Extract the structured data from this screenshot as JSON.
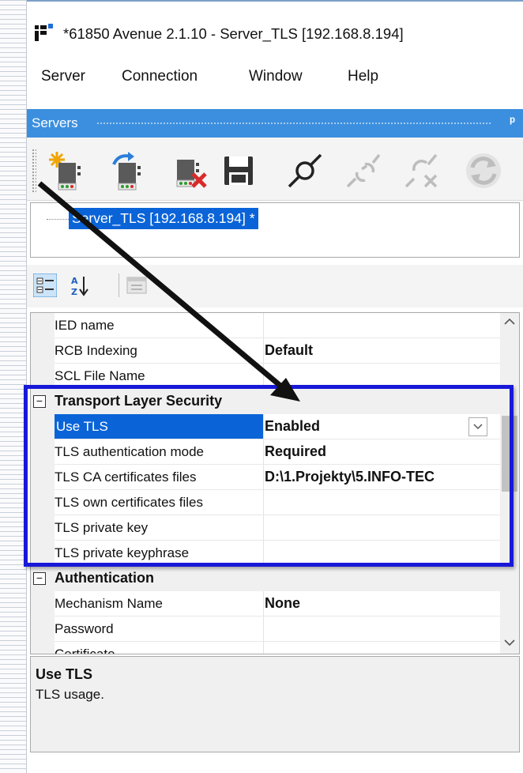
{
  "window": {
    "title": "*61850 Avenue 2.1.10 - Server_TLS [192.168.8.194]"
  },
  "menu": {
    "items": [
      "Server",
      "Connection",
      "Window",
      "Help"
    ]
  },
  "servers_panel": {
    "title": "Servers",
    "pin": "ᵖ",
    "node_label": "Server_TLS [192.168.8.194] *"
  },
  "toolbar": {
    "buttons": [
      "new-server-icon",
      "connect-server-icon",
      "delete-server-icon",
      "save-icon",
      "connect-icon",
      "disconnect-icon",
      "disconnect-all-icon",
      "refresh-icon"
    ]
  },
  "properties": {
    "rows_top": [
      {
        "name": "IED name",
        "value": ""
      },
      {
        "name": "RCB Indexing",
        "value": "Default"
      },
      {
        "name": "SCL File Name",
        "value": ""
      }
    ],
    "tls_category": "Transport Layer Security",
    "tls_rows": [
      {
        "name": "Use TLS",
        "value": "Enabled"
      },
      {
        "name": "TLS authentication mode",
        "value": "Required"
      },
      {
        "name": "TLS CA certificates files",
        "value": "D:\\1.Projekty\\5.INFO-TEC"
      },
      {
        "name": "TLS own certificates files",
        "value": ""
      },
      {
        "name": "TLS private key",
        "value": ""
      },
      {
        "name": "TLS private keyphrase",
        "value": ""
      }
    ],
    "auth_category": "Authentication",
    "auth_rows": [
      {
        "name": "Mechanism Name",
        "value": "None"
      },
      {
        "name": "Password",
        "value": ""
      },
      {
        "name": "Certificate",
        "value": ""
      }
    ]
  },
  "description": {
    "title": "Use TLS",
    "text": "TLS usage."
  },
  "colors": {
    "selection": "#0a64d8",
    "header": "#3c8fde",
    "highlight_border": "#1818d8"
  }
}
